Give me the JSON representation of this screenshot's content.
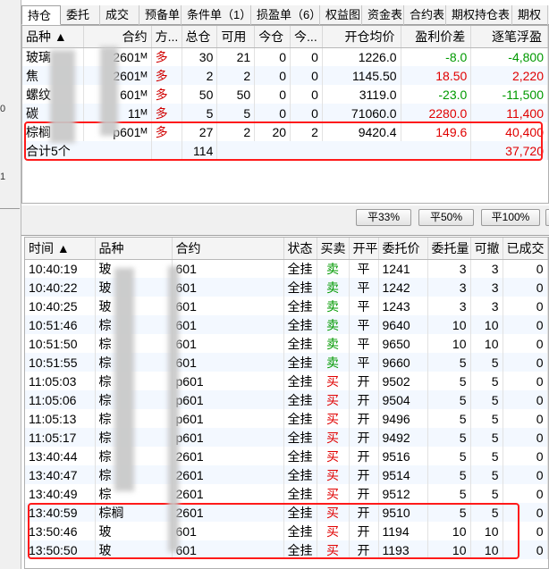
{
  "left_markers": [
    "0",
    "1"
  ],
  "tabs": [
    "持仓",
    "委托",
    "成交",
    "预备单",
    "条件单（1）",
    "损盈单（6）",
    "权益图",
    "资金表",
    "合约表",
    "期权持仓表",
    "期权"
  ],
  "positions": {
    "headers": [
      "品种 ▲",
      "合约",
      "方...",
      "总仓",
      "可用",
      "今仓",
      "今...",
      "开仓均价",
      "盈利价差",
      "逐笔浮盈"
    ],
    "rows": [
      {
        "name": "玻璃",
        "contract": "2601ᴹ",
        "dir": "多",
        "total": "30",
        "avail": "21",
        "today": "0",
        "today2": "0",
        "avg": "1226.0",
        "diff": "-8.0",
        "pnl": "-4,800",
        "diff_color": "#009900",
        "pnl_color": "#009900"
      },
      {
        "name": "焦",
        "contract": "2601ᴹ",
        "dir": "多",
        "total": "2",
        "avail": "2",
        "today": "0",
        "today2": "0",
        "avg": "1145.50",
        "diff": "18.50",
        "pnl": "2,220",
        "diff_color": "#e00000",
        "pnl_color": "#e00000"
      },
      {
        "name": "螺纹",
        "contract": "601ᴹ",
        "dir": "多",
        "total": "50",
        "avail": "50",
        "today": "0",
        "today2": "0",
        "avg": "3119.0",
        "diff": "-23.0",
        "pnl": "-11,500",
        "diff_color": "#009900",
        "pnl_color": "#009900"
      },
      {
        "name": "碳",
        "contract": "11ᴹ",
        "dir": "多",
        "total": "5",
        "avail": "5",
        "today": "0",
        "today2": "0",
        "avg": "71060.0",
        "diff": "2280.0",
        "pnl": "11,400",
        "diff_color": "#e00000",
        "pnl_color": "#e00000"
      },
      {
        "name": "棕榈",
        "contract": "p601ᴹ",
        "dir": "多",
        "total": "27",
        "avail": "2",
        "today": "20",
        "today2": "2",
        "avg": "9420.4",
        "diff": "149.6",
        "pnl": "40,400",
        "diff_color": "#e00000",
        "pnl_color": "#e00000"
      }
    ],
    "summary": {
      "label": "合计5个",
      "total": "114",
      "pnl": "37,720"
    }
  },
  "buttons": [
    "平33%",
    "平50%",
    "平100%"
  ],
  "orders": {
    "headers": [
      "时间 ▲",
      "品种",
      "合约",
      "状态",
      "买卖",
      "开平",
      "委托价",
      "委托量",
      "可撤",
      "已成交"
    ],
    "rows": [
      {
        "time": "10:40:19",
        "name": "玻",
        "contract": "601",
        "status": "全挂",
        "side": "卖",
        "oc": "平",
        "price": "1241",
        "qty": "3",
        "cancel": "3",
        "done": "0",
        "side_color": "#009900"
      },
      {
        "time": "10:40:22",
        "name": "玻",
        "contract": "601",
        "status": "全挂",
        "side": "卖",
        "oc": "平",
        "price": "1242",
        "qty": "3",
        "cancel": "3",
        "done": "0",
        "side_color": "#009900"
      },
      {
        "time": "10:40:25",
        "name": "玻",
        "contract": "601",
        "status": "全挂",
        "side": "卖",
        "oc": "平",
        "price": "1243",
        "qty": "3",
        "cancel": "3",
        "done": "0",
        "side_color": "#009900"
      },
      {
        "time": "10:51:46",
        "name": "棕",
        "contract": "601",
        "status": "全挂",
        "side": "卖",
        "oc": "平",
        "price": "9640",
        "qty": "10",
        "cancel": "10",
        "done": "0",
        "side_color": "#009900"
      },
      {
        "time": "10:51:50",
        "name": "棕",
        "contract": "601",
        "status": "全挂",
        "side": "卖",
        "oc": "平",
        "price": "9650",
        "qty": "10",
        "cancel": "10",
        "done": "0",
        "side_color": "#009900"
      },
      {
        "time": "10:51:55",
        "name": "棕",
        "contract": "601",
        "status": "全挂",
        "side": "卖",
        "oc": "平",
        "price": "9660",
        "qty": "5",
        "cancel": "5",
        "done": "0",
        "side_color": "#009900"
      },
      {
        "time": "11:05:03",
        "name": "棕",
        "contract": "p601",
        "status": "全挂",
        "side": "买",
        "oc": "开",
        "price": "9502",
        "qty": "5",
        "cancel": "5",
        "done": "0",
        "side_color": "#e00000"
      },
      {
        "time": "11:05:06",
        "name": "棕",
        "contract": "p601",
        "status": "全挂",
        "side": "买",
        "oc": "开",
        "price": "9504",
        "qty": "5",
        "cancel": "5",
        "done": "0",
        "side_color": "#e00000"
      },
      {
        "time": "11:05:13",
        "name": "棕",
        "contract": "p601",
        "status": "全挂",
        "side": "买",
        "oc": "开",
        "price": "9496",
        "qty": "5",
        "cancel": "5",
        "done": "0",
        "side_color": "#e00000"
      },
      {
        "time": "11:05:17",
        "name": "棕",
        "contract": "p601",
        "status": "全挂",
        "side": "买",
        "oc": "开",
        "price": "9492",
        "qty": "5",
        "cancel": "5",
        "done": "0",
        "side_color": "#e00000"
      },
      {
        "time": "13:40:44",
        "name": "棕",
        "contract": "2601",
        "status": "全挂",
        "side": "买",
        "oc": "开",
        "price": "9516",
        "qty": "5",
        "cancel": "5",
        "done": "0",
        "side_color": "#e00000"
      },
      {
        "time": "13:40:47",
        "name": "棕",
        "contract": "2601",
        "status": "全挂",
        "side": "买",
        "oc": "开",
        "price": "9514",
        "qty": "5",
        "cancel": "5",
        "done": "0",
        "side_color": "#e00000"
      },
      {
        "time": "13:40:49",
        "name": "棕",
        "contract": "2601",
        "status": "全挂",
        "side": "买",
        "oc": "开",
        "price": "9512",
        "qty": "5",
        "cancel": "5",
        "done": "0",
        "side_color": "#e00000"
      },
      {
        "time": "13:40:59",
        "name": "棕榈",
        "contract": "2601",
        "status": "全挂",
        "side": "买",
        "oc": "开",
        "price": "9510",
        "qty": "5",
        "cancel": "5",
        "done": "0",
        "side_color": "#e00000"
      },
      {
        "time": "13:50:46",
        "name": "玻",
        "contract": "601",
        "status": "全挂",
        "side": "买",
        "oc": "开",
        "price": "1194",
        "qty": "10",
        "cancel": "10",
        "done": "0",
        "side_color": "#e00000"
      },
      {
        "time": "13:50:50",
        "name": "玻",
        "contract": "601",
        "status": "全挂",
        "side": "买",
        "oc": "开",
        "price": "1193",
        "qty": "10",
        "cancel": "10",
        "done": "0",
        "side_color": "#e00000"
      }
    ]
  }
}
